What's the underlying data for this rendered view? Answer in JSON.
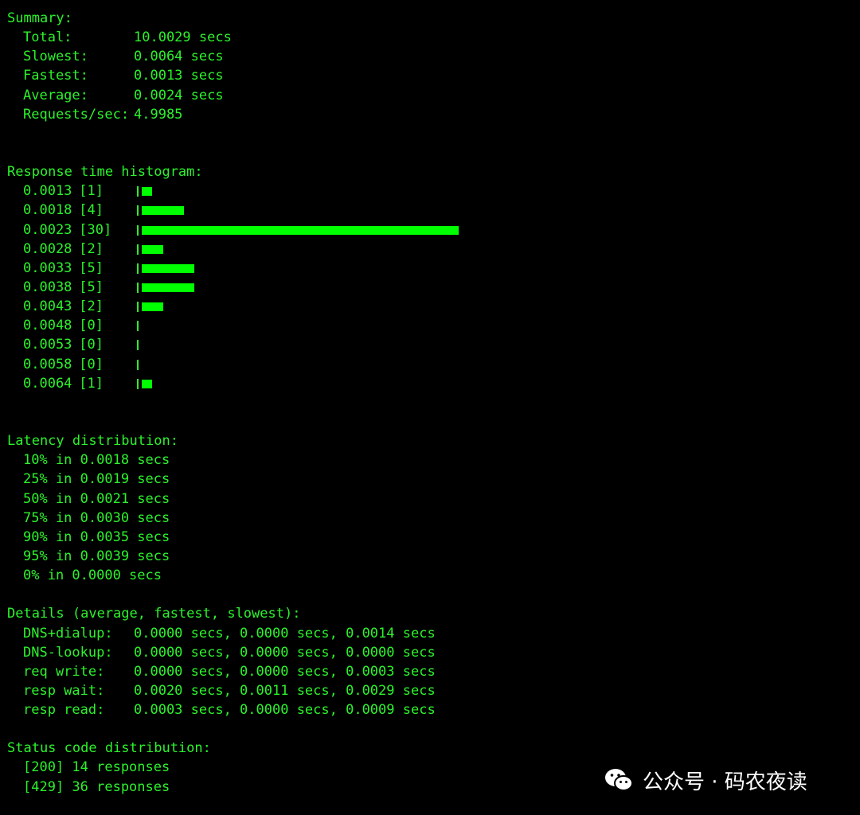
{
  "terminal": {
    "summary": {
      "title": "Summary:",
      "rows": [
        {
          "label": "Total:",
          "value": "10.0029 secs"
        },
        {
          "label": "Slowest:",
          "value": "0.0064 secs"
        },
        {
          "label": "Fastest:",
          "value": "0.0013 secs"
        },
        {
          "label": "Average:",
          "value": "0.0024 secs"
        },
        {
          "label": "Requests/sec:",
          "value": "4.9985"
        }
      ]
    },
    "histogram": {
      "title": "Response time histogram:",
      "rows": [
        {
          "value": "0.0013",
          "count_label": "[1]",
          "count": 1
        },
        {
          "value": "0.0018",
          "count_label": "[4]",
          "count": 4
        },
        {
          "value": "0.0023",
          "count_label": "[30]",
          "count": 30
        },
        {
          "value": "0.0028",
          "count_label": "[2]",
          "count": 2
        },
        {
          "value": "0.0033",
          "count_label": "[5]",
          "count": 5
        },
        {
          "value": "0.0038",
          "count_label": "[5]",
          "count": 5
        },
        {
          "value": "0.0043",
          "count_label": "[2]",
          "count": 2
        },
        {
          "value": "0.0048",
          "count_label": "[0]",
          "count": 0
        },
        {
          "value": "0.0053",
          "count_label": "[0]",
          "count": 0
        },
        {
          "value": "0.0058",
          "count_label": "[0]",
          "count": 0
        },
        {
          "value": "0.0064",
          "count_label": "[1]",
          "count": 1
        }
      ]
    },
    "latency": {
      "title": "Latency distribution:",
      "rows": [
        "10% in 0.0018 secs",
        "25% in 0.0019 secs",
        "50% in 0.0021 secs",
        "75% in 0.0030 secs",
        "90% in 0.0035 secs",
        "95% in 0.0039 secs",
        "0% in 0.0000 secs"
      ]
    },
    "details": {
      "title": "Details (average, fastest, slowest):",
      "rows": [
        {
          "label": "DNS+dialup:",
          "value": "0.0000 secs, 0.0000 secs, 0.0014 secs"
        },
        {
          "label": "DNS-lookup:",
          "value": "0.0000 secs, 0.0000 secs, 0.0000 secs"
        },
        {
          "label": "req write:",
          "value": "0.0000 secs, 0.0000 secs, 0.0003 secs"
        },
        {
          "label": "resp wait:",
          "value": "0.0020 secs, 0.0011 secs, 0.0029 secs"
        },
        {
          "label": "resp read:",
          "value": "0.0003 secs, 0.0000 secs, 0.0009 secs"
        }
      ]
    },
    "status": {
      "title": "Status code distribution:",
      "rows": [
        "[200] 14 responses",
        "[429] 36 responses"
      ]
    }
  },
  "watermark": {
    "text": "公众号 · 码农夜读",
    "icon": "wechat-icon"
  },
  "colors": {
    "background": "#000000",
    "text": "#2cf22c",
    "bar": "#00ff00",
    "watermark": "#ffffff"
  }
}
